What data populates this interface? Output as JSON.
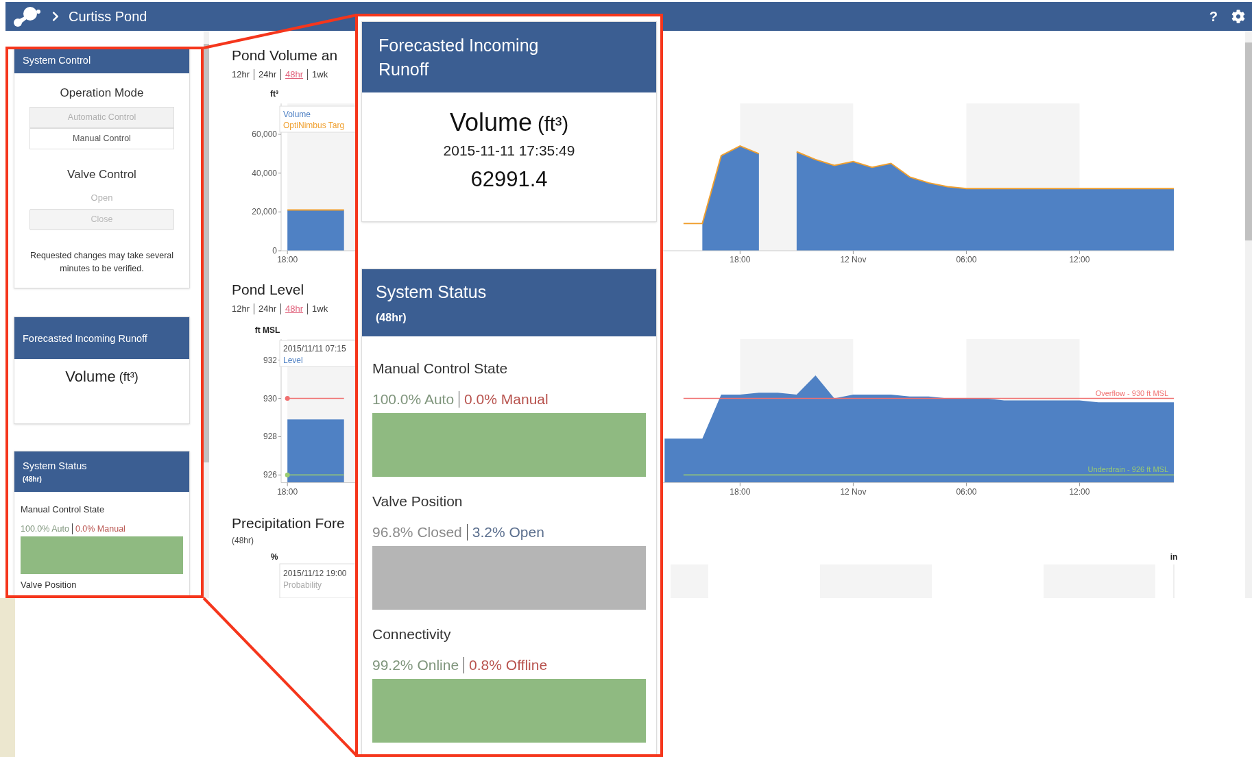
{
  "header": {
    "title": "Curtiss Pond",
    "help": "?"
  },
  "sidebar": {
    "system_control": {
      "title": "System Control",
      "operation_mode": {
        "label": "Operation Mode",
        "buttons": [
          {
            "label": "Automatic Control",
            "disabled": true
          },
          {
            "label": "Manual Control",
            "disabled": false
          }
        ]
      },
      "valve_control": {
        "label": "Valve Control",
        "buttons": [
          {
            "label": "Open",
            "kind": "link",
            "disabled": true
          },
          {
            "label": "Close",
            "kind": "button",
            "disabled": true
          }
        ]
      },
      "note": "Requested changes may take several minutes to be verified."
    },
    "runoff": {
      "title": "Forecasted Incoming Runoff",
      "label": "Volume",
      "unit": "(ft³)"
    },
    "status": {
      "title": "System Status",
      "subtitle": "(48hr)",
      "items": [
        {
          "label": "Manual Control State",
          "parts": [
            {
              "text": "100.0% Auto",
              "color": "#7f957c"
            },
            {
              "text": "0.0% Manual",
              "color": "#b8534e"
            }
          ],
          "color": "#8fba81"
        },
        {
          "label": "Valve Position"
        }
      ]
    }
  },
  "charts": [
    {
      "title": "Pond Volume an",
      "ranges": [
        {
          "label": "12hr",
          "selected": false
        },
        {
          "label": "24hr",
          "selected": false
        },
        {
          "label": "48hr",
          "selected": true
        },
        {
          "label": "1wk",
          "selected": false
        }
      ],
      "unit": "ft³",
      "chart_data": {
        "type": "area",
        "categories": [
          "18:00",
          null,
          null,
          null,
          null,
          null,
          null,
          null,
          null,
          null,
          null,
          null,
          null,
          null,
          null,
          null,
          null,
          null,
          null,
          null,
          null,
          null,
          null,
          null,
          "18:00",
          null,
          null,
          null,
          null,
          null,
          "12 Nov",
          null,
          null,
          null,
          null,
          null,
          "06:00",
          null,
          null,
          null,
          null,
          null,
          "12:00",
          null,
          null,
          null,
          null,
          null
        ],
        "series": [
          {
            "name": "Volume",
            "type": "area",
            "color": "#4f81c4",
            "values": [
              21000,
              21000,
              21000,
              21000,
              null,
              null,
              null,
              null,
              null,
              null,
              null,
              null,
              null,
              null,
              null,
              null,
              null,
              null,
              null,
              null,
              null,
              null,
              14000,
              49000,
              54000,
              50000,
              null,
              51000,
              47000,
              44000,
              46000,
              43000,
              45000,
              38000,
              35000,
              33000,
              32000,
              32000,
              32000,
              32000,
              32000,
              32000,
              32000,
              32000,
              32000,
              32000,
              32000,
              32000
            ]
          },
          {
            "name": "OptiNimbus Targ",
            "type": "line",
            "color": "#f0a030",
            "values": [
              21000,
              21000,
              21000,
              21000,
              null,
              null,
              null,
              null,
              null,
              null,
              null,
              null,
              null,
              null,
              null,
              null,
              null,
              null,
              null,
              null,
              null,
              14000,
              14000,
              49000,
              54000,
              50000,
              null,
              51000,
              47000,
              44000,
              46000,
              43000,
              45000,
              38000,
              35000,
              33000,
              32000,
              32000,
              32000,
              32000,
              32000,
              32000,
              32000,
              32000,
              32000,
              32000,
              32000,
              32000
            ]
          }
        ],
        "ylim": [
          0,
          75900
        ],
        "yticks": [
          {
            "value": 0,
            "label": "0"
          },
          {
            "value": 20000,
            "label": "20,000"
          },
          {
            "value": 40000,
            "label": "40,000"
          },
          {
            "value": 60000,
            "label": "60,000"
          }
        ]
      }
    },
    {
      "title": "Pond Level",
      "ranges": [
        {
          "label": "12hr",
          "selected": false
        },
        {
          "label": "24hr",
          "selected": false
        },
        {
          "label": "48hr",
          "selected": true
        },
        {
          "label": "1wk",
          "selected": false
        }
      ],
      "unit": "ft MSL",
      "tooltip_time": "2015/11/11 07:15",
      "chart_data": {
        "type": "area",
        "categories": [
          "18:00",
          null,
          null,
          null,
          null,
          null,
          null,
          null,
          null,
          null,
          null,
          null,
          null,
          null,
          null,
          null,
          null,
          null,
          null,
          null,
          null,
          null,
          null,
          null,
          "18:00",
          null,
          null,
          null,
          null,
          null,
          "12 Nov",
          null,
          null,
          null,
          null,
          null,
          "06:00",
          null,
          null,
          null,
          null,
          null,
          "12:00",
          null,
          null,
          null,
          null,
          null
        ],
        "series": [
          {
            "name": "Level",
            "type": "area",
            "color": "#4f81c4",
            "values": [
              928.9,
              928.9,
              928.9,
              928.9,
              null,
              null,
              null,
              null,
              null,
              null,
              null,
              null,
              null,
              null,
              null,
              null,
              null,
              null,
              null,
              null,
              927.9,
              927.9,
              927.9,
              930.2,
              930.2,
              930.3,
              930.3,
              930.2,
              931.2,
              930.0,
              930.2,
              930.2,
              930.2,
              930.1,
              930.1,
              930.0,
              930.0,
              930.0,
              929.9,
              929.9,
              929.9,
              929.9,
              929.9,
              929.8,
              929.8,
              929.8,
              929.8,
              929.8
            ]
          },
          {
            "name": "Overflow - 930 ft MSL",
            "type": "line",
            "color": "#f07070",
            "values": [
              930,
              930,
              930,
              930,
              null,
              null,
              null,
              null,
              null,
              null,
              null,
              null,
              null,
              null,
              null,
              null,
              null,
              null,
              null,
              null,
              null,
              930,
              930,
              930,
              930,
              930,
              930,
              930,
              930,
              930,
              930,
              930,
              930,
              930,
              930,
              930,
              930,
              930,
              930,
              930,
              930,
              930,
              930,
              930,
              930,
              930,
              930,
              930
            ]
          },
          {
            "name": "Underdrain - 926 ft MSL",
            "type": "line",
            "color": "#9acb70",
            "values": [
              926,
              926,
              926,
              926,
              null,
              null,
              null,
              null,
              null,
              null,
              null,
              null,
              null,
              null,
              null,
              null,
              null,
              null,
              null,
              null,
              null,
              926,
              926,
              926,
              926,
              926,
              926,
              926,
              926,
              926,
              926,
              926,
              926,
              926,
              926,
              926,
              926,
              926,
              926,
              926,
              926,
              926,
              926,
              926,
              926,
              926,
              926,
              926
            ]
          }
        ],
        "ylim": [
          925.6,
          933.1
        ],
        "yticks": [
          {
            "value": 926,
            "label": "926"
          },
          {
            "value": 928,
            "label": "928"
          },
          {
            "value": 930,
            "label": "930"
          },
          {
            "value": 932,
            "label": "932"
          }
        ]
      }
    },
    {
      "title": "Precipitation Fore",
      "subtitle": "(48hr)",
      "unit": "%",
      "unit_right": "in",
      "tooltip": [
        "2015/11/12 19:00",
        "Probability"
      ]
    }
  ],
  "callout": {
    "runoff": {
      "title": "Forecasted Incoming Runoff",
      "label": "Volume",
      "unit": "(ft³)",
      "timestamp": "2015-11-11 17:35:49",
      "value": "62991.4"
    },
    "status": {
      "title": "System Status",
      "subtitle": "(48hr)",
      "items": [
        {
          "label": "Manual Control State",
          "parts": [
            {
              "text": "100.0% Auto",
              "color": "#7f957c"
            },
            {
              "text": "0.0% Manual",
              "color": "#b8534e"
            }
          ],
          "color": "#8fba81"
        },
        {
          "label": "Valve Position",
          "parts": [
            {
              "text": "96.8% Closed",
              "color": "#8a8a8a"
            },
            {
              "text": "3.2% Open",
              "color": "#5b6f8e"
            }
          ],
          "color": "#b5b5b5"
        },
        {
          "label": "Connectivity",
          "parts": [
            {
              "text": "99.2% Online",
              "color": "#7f957c"
            },
            {
              "text": "0.8% Offline",
              "color": "#b8534e"
            }
          ],
          "color": "#8fba81"
        }
      ]
    }
  }
}
